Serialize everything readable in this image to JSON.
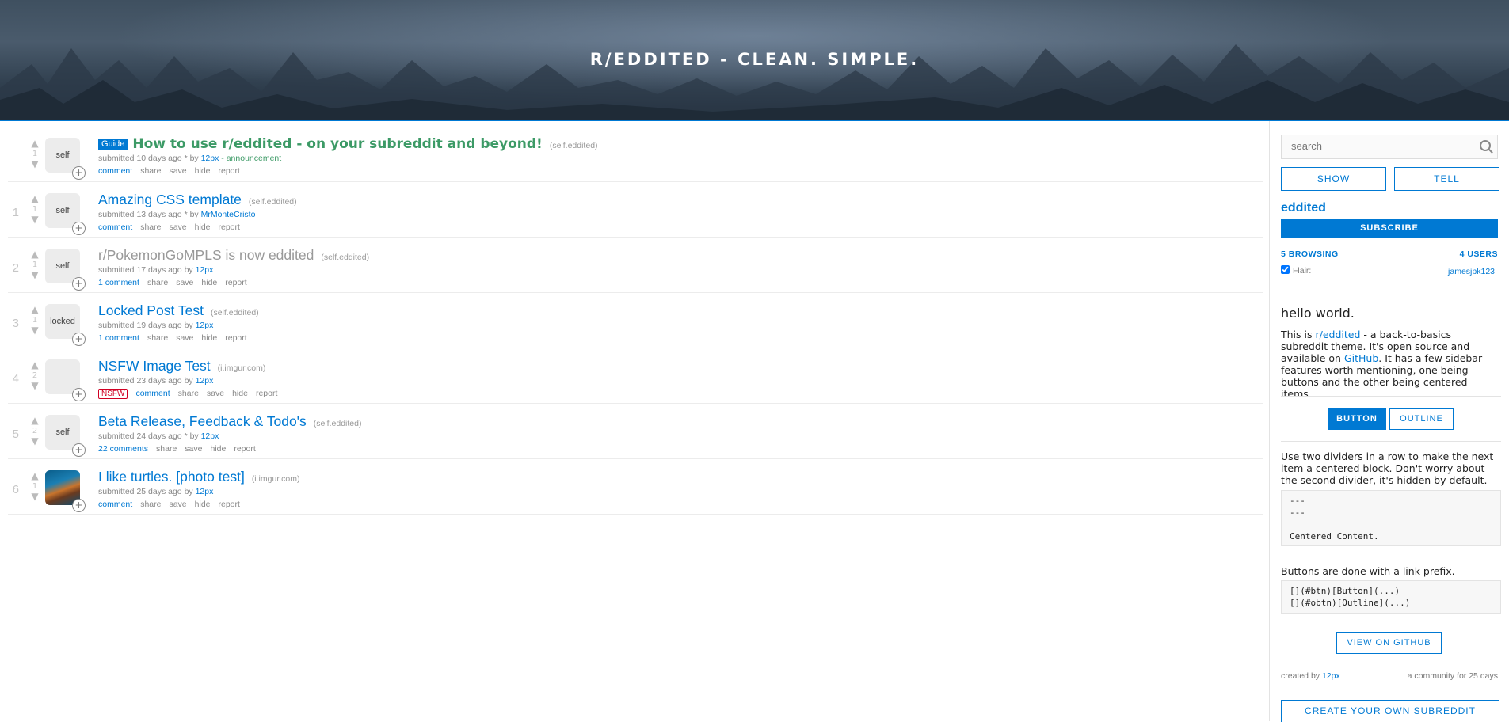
{
  "header": {
    "title": "R/EDDITED - CLEAN. SIMPLE."
  },
  "posts": [
    {
      "rank": "",
      "score": "1",
      "thumb": "self",
      "flair": "Guide",
      "title": "How to use r/eddited - on your subreddit and beyond!",
      "domain": "(self.eddited)",
      "submitted": "submitted 10 days ago * by",
      "author": "12px",
      "extra": " - announcement",
      "comments": "comment",
      "share": "share",
      "save": "save",
      "hide": "hide",
      "report": "report"
    },
    {
      "rank": "1",
      "score": "1",
      "thumb": "self",
      "title": "Amazing CSS template",
      "domain": "(self.eddited)",
      "submitted": "submitted 13 days ago * by",
      "author": "MrMonteCristo",
      "comments": "comment",
      "share": "share",
      "save": "save",
      "hide": "hide",
      "report": "report"
    },
    {
      "rank": "2",
      "score": "1",
      "thumb": "self",
      "title": "r/PokemonGoMPLS is now eddited",
      "domain": "(self.eddited)",
      "submitted": "submitted 17 days ago by",
      "author": "12px",
      "comments": "1 comment",
      "share": "share",
      "save": "save",
      "hide": "hide",
      "report": "report"
    },
    {
      "rank": "3",
      "score": "1",
      "thumb": "locked",
      "title": "Locked Post Test",
      "domain": "(self.eddited)",
      "submitted": "submitted 19 days ago by",
      "author": "12px",
      "comments": "1 comment",
      "share": "share",
      "save": "save",
      "hide": "hide",
      "report": "report"
    },
    {
      "rank": "4",
      "score": "2",
      "thumb": "",
      "title": "NSFW Image Test",
      "domain": "(i.imgur.com)",
      "submitted": "submitted 23 days ago by",
      "author": "12px",
      "nsfw": "NSFW",
      "comments": "comment",
      "share": "share",
      "save": "save",
      "hide": "hide",
      "report": "report"
    },
    {
      "rank": "5",
      "score": "2",
      "thumb": "self",
      "title": "Beta Release, Feedback & Todo's",
      "domain": "(self.eddited)",
      "submitted": "submitted 24 days ago * by",
      "author": "12px",
      "comments": "22 comments",
      "share": "share",
      "save": "save",
      "hide": "hide",
      "report": "report"
    },
    {
      "rank": "6",
      "score": "1",
      "thumb": "",
      "title": "I like turtles. [photo test]",
      "domain": "(i.imgur.com)",
      "submitted": "submitted 25 days ago by",
      "author": "12px",
      "comments": "comment",
      "share": "share",
      "save": "save",
      "hide": "hide",
      "report": "report"
    }
  ],
  "sidebar": {
    "search_placeholder": "search",
    "show": "SHOW",
    "tell": "TELL",
    "name": "eddited",
    "subscribe": "SUBSCRIBE",
    "browsing": "5 BROWSING",
    "users": "4 USERS",
    "flair_label": "Flair:",
    "flair_value": "jamesjpk123",
    "hello": "hello world.",
    "about_1": "This is ",
    "about_link": "r/eddited",
    "about_2": " - a back-to-basics subreddit theme. It's open source and available on ",
    "about_github": "GitHub",
    "about_3": ". It has a few sidebar features worth mentioning, one being buttons and the other being centered items.",
    "button": "BUTTON",
    "outline": "OUTLINE",
    "dividers_text": "Use two dividers in a row to make the next item a centered block. Don't worry about the second divider, it's hidden by default.",
    "code1": "---\n---\n\nCentered Content.",
    "buttons_text": "Buttons are done with a link prefix.",
    "code2": "[](#btn)[Button](...)\n[](#obtn)[Outline](...)",
    "view_github": "VIEW ON GITHUB",
    "created_by": "created by",
    "created_user": "12px",
    "community_age": "a community for 25 days",
    "create": "CREATE YOUR OWN SUBREDDIT"
  }
}
